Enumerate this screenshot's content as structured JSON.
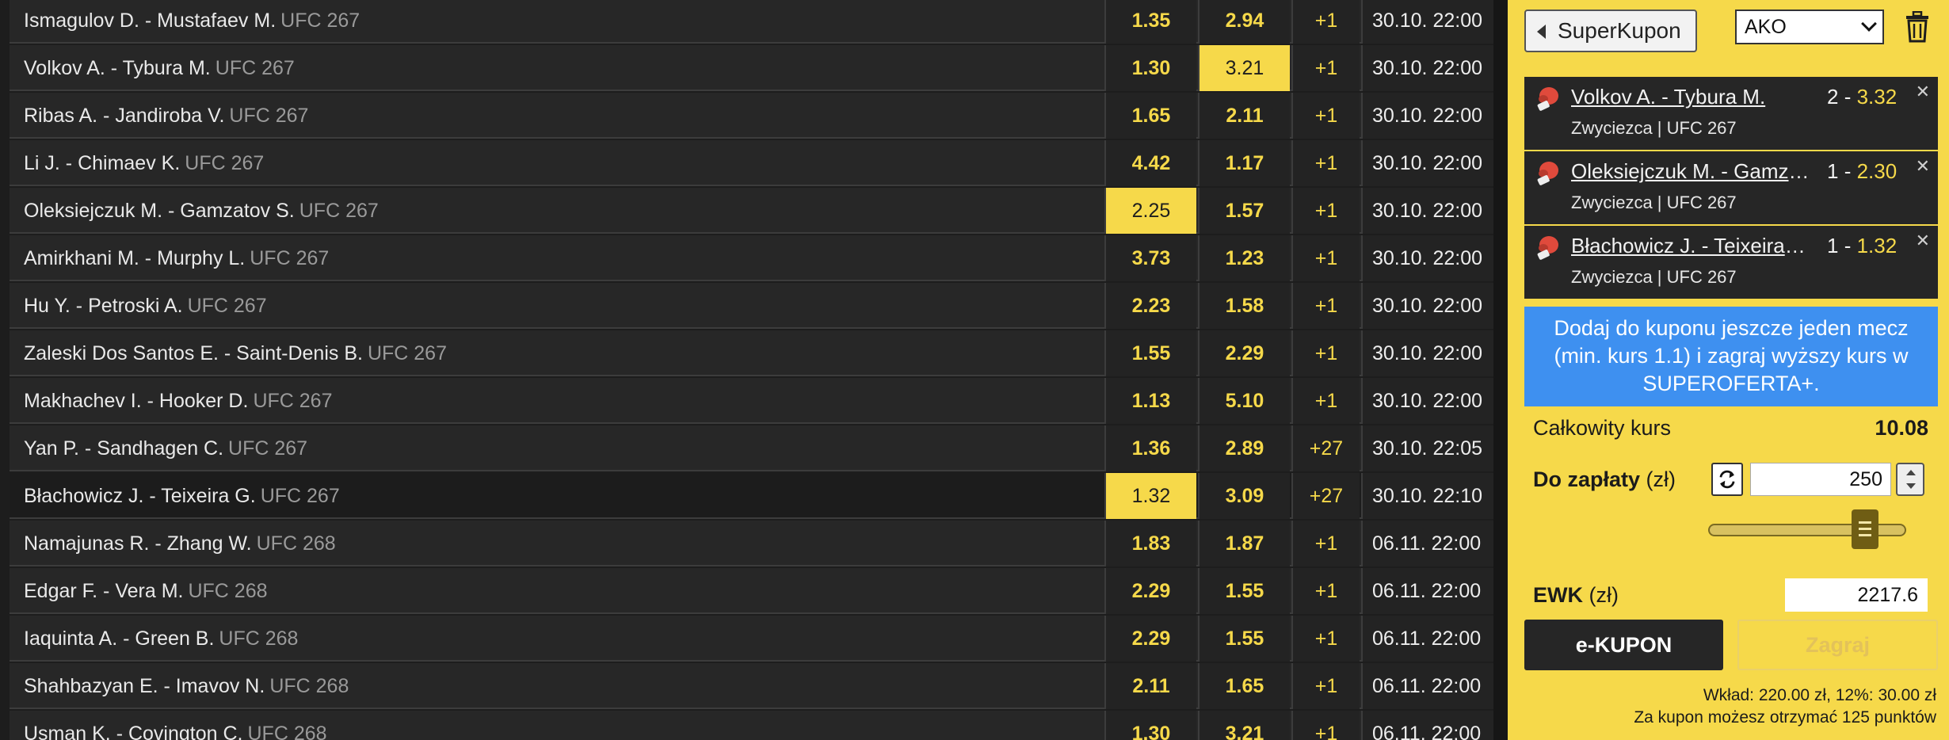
{
  "events": [
    {
      "name": "Ismagulov D. - Mustafaev M.",
      "league": "UFC 267",
      "odd1": "1.35",
      "odd2": "2.94",
      "more": "+1",
      "date": "30.10. 22:00",
      "picked": null
    },
    {
      "name": "Volkov A. - Tybura M.",
      "league": "UFC 267",
      "odd1": "1.30",
      "odd2": "3.21",
      "more": "+1",
      "date": "30.10. 22:00",
      "picked": 2
    },
    {
      "name": "Ribas A. - Jandiroba V.",
      "league": "UFC 267",
      "odd1": "1.65",
      "odd2": "2.11",
      "more": "+1",
      "date": "30.10. 22:00",
      "picked": null
    },
    {
      "name": "Li J. - Chimaev K.",
      "league": "UFC 267",
      "odd1": "4.42",
      "odd2": "1.17",
      "more": "+1",
      "date": "30.10. 22:00",
      "picked": null
    },
    {
      "name": "Oleksiejczuk M. - Gamzatov S.",
      "league": "UFC 267",
      "odd1": "2.25",
      "odd2": "1.57",
      "more": "+1",
      "date": "30.10. 22:00",
      "picked": 1
    },
    {
      "name": "Amirkhani M. - Murphy L.",
      "league": "UFC 267",
      "odd1": "3.73",
      "odd2": "1.23",
      "more": "+1",
      "date": "30.10. 22:00",
      "picked": null
    },
    {
      "name": "Hu Y. - Petroski A.",
      "league": "UFC 267",
      "odd1": "2.23",
      "odd2": "1.58",
      "more": "+1",
      "date": "30.10. 22:00",
      "picked": null
    },
    {
      "name": "Zaleski Dos Santos E. - Saint-Denis B.",
      "league": "UFC 267",
      "odd1": "1.55",
      "odd2": "2.29",
      "more": "+1",
      "date": "30.10. 22:00",
      "picked": null
    },
    {
      "name": "Makhachev I. - Hooker D.",
      "league": "UFC 267",
      "odd1": "1.13",
      "odd2": "5.10",
      "more": "+1",
      "date": "30.10. 22:00",
      "picked": null
    },
    {
      "name": "Yan P. - Sandhagen C.",
      "league": "UFC 267",
      "odd1": "1.36",
      "odd2": "2.89",
      "more": "+27",
      "date": "30.10. 22:05",
      "picked": null
    },
    {
      "name": "Błachowicz J. - Teixeira G.",
      "league": "UFC 267",
      "odd1": "1.32",
      "odd2": "3.09",
      "more": "+27",
      "date": "30.10. 22:10",
      "picked": 1
    },
    {
      "name": "Namajunas R. - Zhang W.",
      "league": "UFC 268",
      "odd1": "1.83",
      "odd2": "1.87",
      "more": "+1",
      "date": "06.11. 22:00",
      "picked": null
    },
    {
      "name": "Edgar F. - Vera M.",
      "league": "UFC 268",
      "odd1": "2.29",
      "odd2": "1.55",
      "more": "+1",
      "date": "06.11. 22:00",
      "picked": null
    },
    {
      "name": "Iaquinta A. - Green B.",
      "league": "UFC 268",
      "odd1": "2.29",
      "odd2": "1.55",
      "more": "+1",
      "date": "06.11. 22:00",
      "picked": null
    },
    {
      "name": "Shahbazyan E. - Imavov N.",
      "league": "UFC 268",
      "odd1": "2.11",
      "odd2": "1.65",
      "more": "+1",
      "date": "06.11. 22:00",
      "picked": null
    },
    {
      "name": "Usman K. - Covington C.",
      "league": "UFC 268",
      "odd1": "1.30",
      "odd2": "3.21",
      "more": "+1",
      "date": "06.11. 22:00",
      "picked": null
    }
  ],
  "coupon": {
    "back_label": "SuperKupon",
    "type_value": "AKO",
    "bets": [
      {
        "match": "Volkov A. - Tybura M.",
        "selection": "2",
        "odd": "3.32",
        "meta": "Zwyciezca | UFC 267",
        "icon": "boxing-glove-icon"
      },
      {
        "match": "Oleksiejczuk M. - Gamzatov S.",
        "selection": "1",
        "odd": "2.30",
        "meta": "Zwyciezca | UFC 267",
        "icon": "boxing-glove-icon"
      },
      {
        "match": "Błachowicz J. - Teixeira G.",
        "selection": "1",
        "odd": "1.32",
        "meta": "Zwyciezca | UFC 267",
        "icon": "boxing-glove-icon"
      }
    ],
    "promo_lines": [
      "Dodaj do kuponu jeszcze jeden mecz",
      "(min. kurs 1.1) i zagraj wyższy kurs w",
      "SUPEROFERTA+."
    ],
    "total_label": "Całkowity kurs",
    "total_value": "10.08",
    "stake_label": "Do zapłaty",
    "stake_unit": "(zł)",
    "stake_value": "250",
    "slider_level": 0.84,
    "ewk_label": "EWK",
    "ewk_unit": "(zł)",
    "ewk_value": "2217.6",
    "ekupon_label": "e-KUPON",
    "play_label": "Zagraj",
    "note_1": "Wkład: 220.00 zł, 12%: 30.00 zł",
    "note_2": "Za kupon możesz otrzymać 125 punktów",
    "colors": {
      "accent": "#f6d94a",
      "dark": "#262626",
      "promo": "#3e90f0"
    }
  }
}
